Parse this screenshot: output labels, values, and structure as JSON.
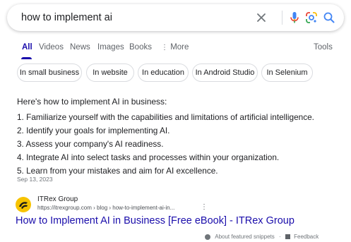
{
  "search": {
    "query": "how to implement ai"
  },
  "icons": {
    "clear": "close-icon",
    "voice": "microphone-icon",
    "lens": "google-lens-icon",
    "search": "search-icon",
    "more": "more-vertical-dots-icon",
    "featured_info": "question-circle-icon",
    "feedback": "feedback-flag-icon"
  },
  "tabs": {
    "all": "All",
    "videos": "Videos",
    "news": "News",
    "images": "Images",
    "books": "Books",
    "more": "More",
    "tools": "Tools"
  },
  "chips": [
    "In small business",
    "In website",
    "In education",
    "In Android Studio",
    "In Selenium"
  ],
  "snippet": {
    "title": "Here's how to implement AI in business:",
    "steps": [
      "1. Familiarize yourself with the capabilities and limitations of artificial intelligence.",
      "2. Identify your goals for implementing AI.",
      "3. Assess your company's AI readiness.",
      "4. Integrate AI into select tasks and processes within your organization.",
      "5. Learn from your mistakes and aim for AI excellence."
    ],
    "date": "Sep 13, 2023"
  },
  "result": {
    "site_name": "ITRex Group",
    "url": "https://itrexgroup.com › blog › how-to-implement-ai-in...",
    "title": "How to Implement AI in Business [Free eBook] - ITRex Group"
  },
  "footer": {
    "about": "About featured snippets",
    "separator": "·",
    "feedback": "Feedback"
  },
  "colors": {
    "link": "#1a0dab",
    "mic_blue": "#4285f4",
    "mic_red": "#ea4335",
    "favicon_yellow": "#f7c300"
  }
}
